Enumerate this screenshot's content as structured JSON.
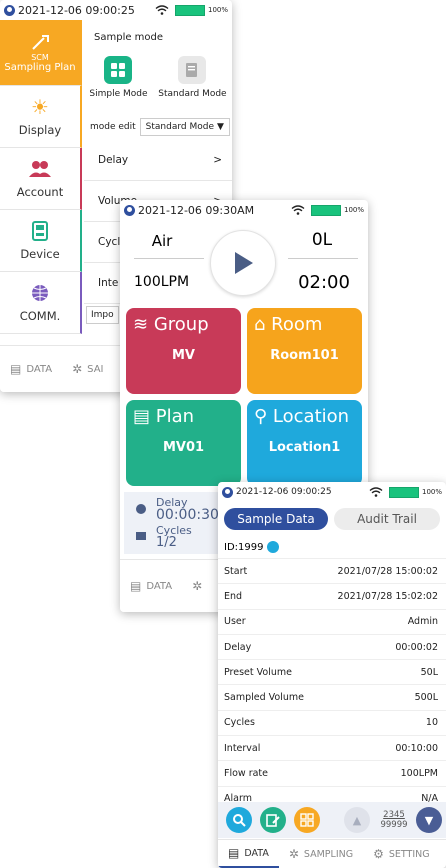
{
  "screen1": {
    "status_time": "2021-12-06 09:00:25",
    "battery": "100%",
    "sidebar": [
      {
        "label": "Sampling Plan",
        "badge": "SCM",
        "icon": "sampling-plan-icon"
      },
      {
        "label": "Display",
        "icon": "sun-icon"
      },
      {
        "label": "Account",
        "icon": "users-icon"
      },
      {
        "label": "Device",
        "icon": "device-icon"
      },
      {
        "label": "COMM.",
        "icon": "globe-icon"
      }
    ],
    "section_title": "Sample mode",
    "mode_simple": "Simple Mode",
    "mode_standard": "Standard Mode",
    "mode_edit_label": "mode edit",
    "mode_edit_value": "Standard Mode",
    "rows": [
      {
        "label": "Delay",
        "arrow": ">"
      },
      {
        "label": "Volume",
        "arrow": ">"
      },
      {
        "label": "Cycl",
        "arrow": ""
      },
      {
        "label": "Inte",
        "arrow": ""
      }
    ],
    "import_label": "Impo",
    "nav_data": "DATA",
    "nav_sampling": "SAI"
  },
  "screen2": {
    "status_time": "2021-12-06 09:30AM",
    "battery": "100%",
    "gas": "Air",
    "volume": "0L",
    "flow": "100LPM",
    "time": "02:00",
    "tiles": [
      {
        "label": "Group",
        "value": "MV",
        "color": "#c83a58",
        "icon": "layers-icon"
      },
      {
        "label": "Room",
        "value": "Room101",
        "color": "#f6a41c",
        "icon": "home-icon"
      },
      {
        "label": "Plan",
        "value": "MV01",
        "color": "#22b08a",
        "icon": "document-icon"
      },
      {
        "label": "Location",
        "value": "Location1",
        "color": "#1fa9dc",
        "icon": "location-pin-icon"
      }
    ],
    "delay_label": "Delay",
    "delay_value": "00:00:30",
    "cycles_label": "Cycles",
    "cycles_value": "1/2",
    "nav_data": "DATA"
  },
  "screen3": {
    "status_time": "2021-12-06 09:00:25",
    "battery": "100%",
    "tab_sample": "Sample Data",
    "tab_audit": "Audit Trail",
    "id_label": "ID:1999",
    "rows": [
      {
        "label": "Start",
        "value": "2021/07/28 15:00:02"
      },
      {
        "label": "End",
        "value": "2021/07/28 15:02:02"
      },
      {
        "label": "User",
        "value": "Admin"
      },
      {
        "label": "Delay",
        "value": "00:00:02"
      },
      {
        "label": "Preset Volume",
        "value": "50L"
      },
      {
        "label": "Sampled Volume",
        "value": "500L"
      },
      {
        "label": "Cycles",
        "value": "10"
      },
      {
        "label": "Interval",
        "value": "00:10:00"
      },
      {
        "label": "Flow rate",
        "value": "100LPM"
      },
      {
        "label": "Alarm",
        "value": "N/A"
      }
    ],
    "page_current": "2345",
    "page_total": "99999",
    "nav_data": "DATA",
    "nav_sampling": "SAMPLING",
    "nav_setting": "SETTING"
  },
  "colors": {
    "orange": "#f7a823",
    "blue_dark": "#2f4f9e",
    "green": "#19c37d",
    "teal": "#22b08a"
  }
}
